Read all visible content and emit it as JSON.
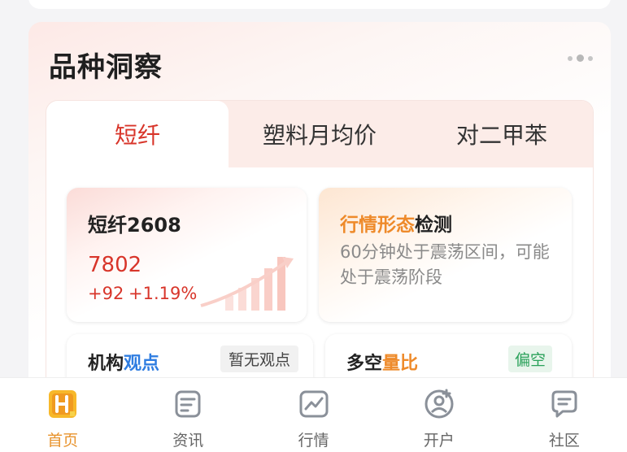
{
  "section": {
    "title": "品种洞察"
  },
  "tabs": [
    {
      "label": "短纤"
    },
    {
      "label": "塑料月均价"
    },
    {
      "label": "对二甲苯"
    }
  ],
  "quote_card": {
    "name": "短纤2608",
    "price": "7802",
    "change": "+92",
    "change_pct": "+1.19%"
  },
  "pattern_card": {
    "title_highlight": "行情形态",
    "title_rest": "检测",
    "description": "60分钟处于震荡区间，可能处于震荡阶段"
  },
  "institution_card": {
    "title_a": "机构",
    "title_b": "观点",
    "badge": "暂无观点"
  },
  "ratio_card": {
    "title_a": "多空",
    "title_b": "量比",
    "badge": "偏空"
  },
  "bottom_nav": [
    {
      "label": "首页",
      "icon": "home-icon"
    },
    {
      "label": "资讯",
      "icon": "news-icon"
    },
    {
      "label": "行情",
      "icon": "market-chart-icon"
    },
    {
      "label": "开户",
      "icon": "account-open-icon"
    },
    {
      "label": "社区",
      "icon": "community-chat-icon"
    }
  ],
  "colors": {
    "accent_red": "#d8352a",
    "accent_orange": "#ee8a2a",
    "accent_blue": "#2f7de1",
    "accent_green": "#2aa15a"
  }
}
